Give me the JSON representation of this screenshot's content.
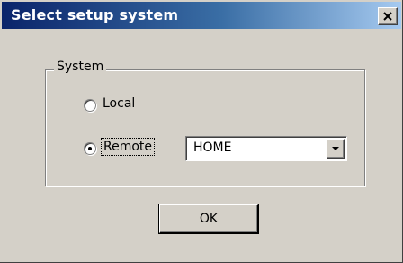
{
  "dialog": {
    "title": "Select setup system",
    "close_glyph": "close-icon"
  },
  "group": {
    "legend": "System",
    "options": [
      {
        "label": "Local",
        "selected": false
      },
      {
        "label": "Remote",
        "selected": true
      }
    ]
  },
  "remote_select": {
    "value": "HOME"
  },
  "ok_button": {
    "label": "OK"
  }
}
